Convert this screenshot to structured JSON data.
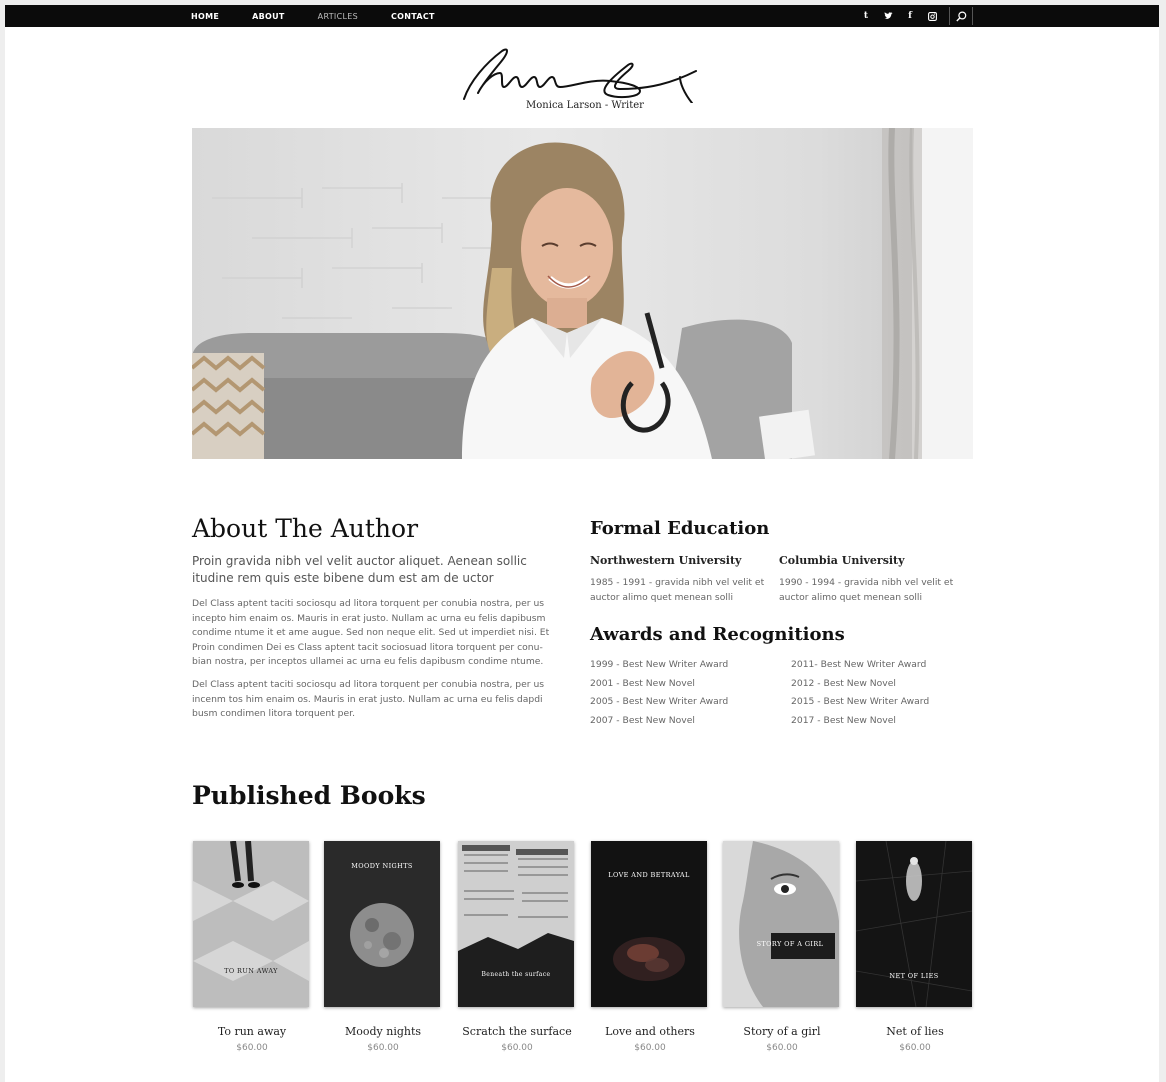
{
  "nav": {
    "items": [
      {
        "label": "HOME"
      },
      {
        "label": "ABOUT"
      },
      {
        "label": "ARTICLES"
      },
      {
        "label": "CONTACT"
      }
    ],
    "social_icons": [
      "tumblr-icon",
      "twitter-icon",
      "facebook-icon",
      "instagram-icon"
    ],
    "search_icon": "search-icon"
  },
  "brand": {
    "tagline": "Monica Larson - Writer"
  },
  "about": {
    "title": "About The Author",
    "lead": "Proin gravida nibh vel velit auctor aliquet. Aenean sollic itudine rem quis este bibene dum est am de uctor",
    "paragraphs": [
      "Del Class aptent taciti sociosqu ad litora torquent per conubia nostra, per us incepto him enaim os. Mauris in erat justo. Nullam ac urna eu felis dapibusm condime ntume it et ame augue. Sed non neque elit. Sed ut imperdiet nisi. Et Proin condimen Dei es Class aptent tacit sociosuad litora torquent per conu-bian nostra, per inceptos ullamei ac urna eu felis dapibusm condime ntume.",
      "Del Class aptent taciti sociosqu ad litora torquent per conubia nostra, per us incenm tos him enaim os. Mauris in erat justo. Nullam ac urna eu felis dapdi busm condimen litora torquent per."
    ]
  },
  "education": {
    "title": "Formal Education",
    "schools": [
      {
        "name": "Northwestern University",
        "desc": "1985 - 1991 - gravida nibh vel velit et auctor alimo quet menean solli"
      },
      {
        "name": "Columbia University",
        "desc": "1990 - 1994 - gravida nibh vel velit et auctor alimo quet menean solli"
      }
    ]
  },
  "awards": {
    "title": "Awards and Recognitions",
    "left": [
      "1999 - Best New Writer Award",
      "2001 - Best New Novel",
      "2005 - Best New Writer Award",
      "2007 - Best New Novel"
    ],
    "right": [
      "2011- Best New Writer Award",
      "2012 - Best New Novel",
      "2015 - Best New Writer Award",
      "2017 - Best New Novel"
    ]
  },
  "books": {
    "title": "Published Books",
    "items": [
      {
        "title": "To run away",
        "price": "$60.00",
        "cover_title": "TO RUN AWAY"
      },
      {
        "title": "Moody nights",
        "price": "$60.00",
        "cover_title": "MOODY NIGHTS"
      },
      {
        "title": "Scratch the surface",
        "price": "$60.00",
        "cover_title": "Beneath the surface"
      },
      {
        "title": "Love and others",
        "price": "$60.00",
        "cover_title": "LOVE AND BETRAYAL"
      },
      {
        "title": "Story of a girl",
        "price": "$60.00",
        "cover_title": "STORY OF A GIRL"
      },
      {
        "title": "Net of lies",
        "price": "$60.00",
        "cover_title": "NET OF LIES"
      }
    ]
  },
  "colors": {
    "topbar": "#0b0b0b",
    "text": "#111111",
    "muted": "#666666"
  }
}
